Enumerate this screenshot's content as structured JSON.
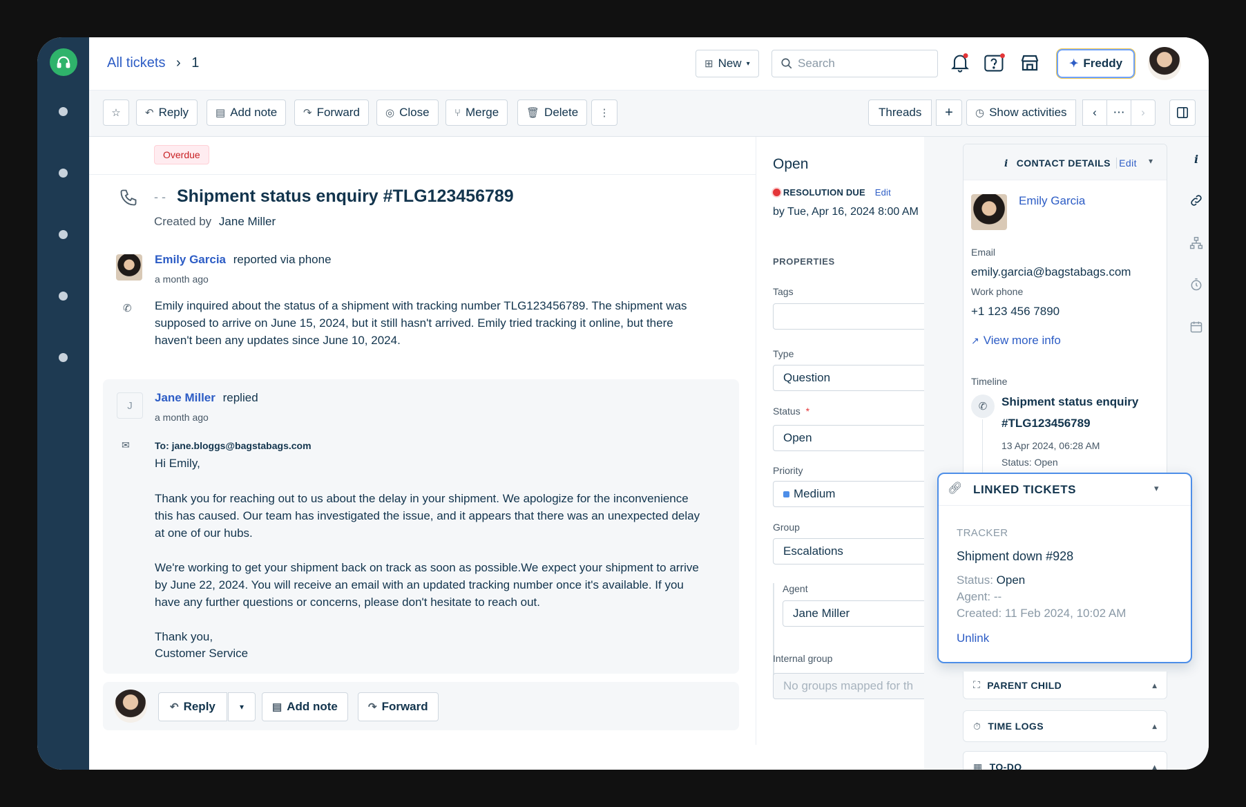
{
  "breadcrumb": {
    "root": "All tickets",
    "separator": "›",
    "current": "1"
  },
  "header": {
    "new_label": "New",
    "search_placeholder": "Search",
    "freddy_label": "Freddy"
  },
  "toolbar": {
    "reply": "Reply",
    "add_note": "Add note",
    "forward": "Forward",
    "close": "Close",
    "merge": "Merge",
    "delete": "Delete",
    "threads": "Threads",
    "show_activities": "Show activities",
    "more": "⋯"
  },
  "ticket": {
    "badge": "Overdue",
    "dash": "- -",
    "title": "Shipment status enquiry #TLG123456789",
    "created_by_label": "Created by",
    "created_by": "Jane Miller"
  },
  "conversation": [
    {
      "author": "Emily Garcia",
      "action": "reported via phone",
      "time": "a month ago",
      "body": "Emily inquired about the status of a shipment with tracking number TLG123456789. The shipment was supposed to arrive on June 15, 2024, but it still hasn't arrived. Emily tried tracking it online, but there haven't been any updates since June 10, 2024."
    },
    {
      "author": "Jane Miller",
      "initial": "J",
      "action": "replied",
      "time": "a month ago",
      "to": "To: jane.bloggs@bagstabags.com",
      "greeting": "Hi Emily,",
      "para1": "Thank you for reaching out to us about the delay in your shipment. We apologize for the inconvenience this has caused. Our team has investigated the issue, and it appears that there was an unexpected delay at one of our hubs.",
      "para2": "We're working to get your shipment back on track as soon as possible.We expect your shipment to arrive by June 22, 2024. You will receive an email with an updated tracking number once it's available. If you have any further questions or concerns, please don't hesitate to reach out.",
      "sign1": "Thank you,",
      "sign2": "Customer Service"
    }
  ],
  "reply_bar": {
    "reply": "Reply",
    "add_note": "Add note",
    "forward": "Forward"
  },
  "properties": {
    "status_heading": "Open",
    "resolution_label": "RESOLUTION DUE",
    "edit": "Edit",
    "due": "by Tue, Apr 16, 2024 8:00 AM",
    "heading": "PROPERTIES",
    "tags_label": "Tags",
    "tags_value": "",
    "type_label": "Type",
    "type_value": "Question",
    "status_label": "Status",
    "required_mark": "*",
    "status_value": "Open",
    "priority_label": "Priority",
    "priority_value": "Medium",
    "group_label": "Group",
    "group_value": "Escalations",
    "agent_label": "Agent",
    "agent_value": "Jane Miller",
    "internal_group_label": "Internal group",
    "internal_group_placeholder": "No groups mapped for th"
  },
  "contact": {
    "heading": "CONTACT DETAILS",
    "edit": "Edit",
    "name": "Emily Garcia",
    "email_label": "Email",
    "email": "emily.garcia@bagstabags.com",
    "phone_label": "Work phone",
    "phone": "+1 123 456 7890",
    "view_more": "View more info",
    "timeline_label": "Timeline",
    "timeline_title_1": "Shipment status enquiry",
    "timeline_title_2": "#TLG123456789",
    "timeline_date": "13 Apr 2024, 06:28 AM",
    "timeline_status": "Status: Open"
  },
  "linked": {
    "heading": "LINKED TICKETS",
    "tracker": "TRACKER",
    "title": "Shipment down #928",
    "status_label": "Status:",
    "status": "Open",
    "agent": "Agent: --",
    "created": "Created: 11 Feb 2024, 10:02 AM",
    "unlink": "Unlink"
  },
  "sections": {
    "parent_child": "PARENT CHILD",
    "time_logs": "TIME LOGS",
    "todo": "TO-DO"
  },
  "colors": {
    "rail": "#1e3a52",
    "accent": "#2c5cc5",
    "logo": "#2fb36b",
    "overdue_bg": "#ffecf0",
    "overdue_text": "#c82124",
    "priority": "#4d8ee8"
  }
}
